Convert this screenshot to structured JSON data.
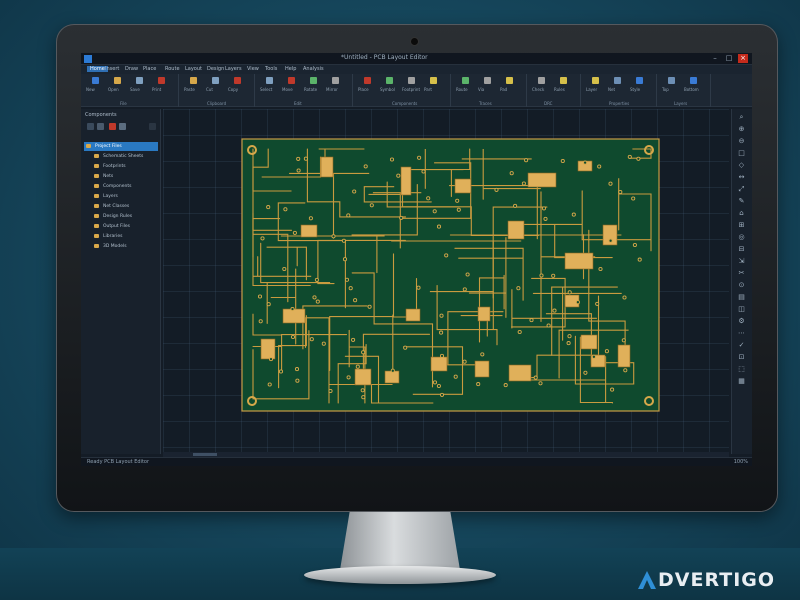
{
  "window": {
    "title": "*Untitled - PCB Layout Editor"
  },
  "menu": {
    "items": [
      "Home",
      "Insert",
      "Draw",
      "Place",
      "Route",
      "Layout",
      "Design",
      "Layers",
      "View",
      "Tools",
      "Help",
      "Analysis"
    ]
  },
  "ribbon": {
    "groups": [
      {
        "name": "File",
        "buttons": [
          "New",
          "Open",
          "Save",
          "Print"
        ]
      },
      {
        "name": "Clipboard",
        "buttons": [
          "Paste",
          "Cut",
          "Copy"
        ]
      },
      {
        "name": "Edit",
        "buttons": [
          "Select",
          "Move",
          "Rotate",
          "Mirror"
        ]
      },
      {
        "name": "Components",
        "buttons": [
          "Place",
          "Symbol",
          "Footprint",
          "Part"
        ]
      },
      {
        "name": "Traces",
        "buttons": [
          "Route",
          "Via",
          "Pad"
        ]
      },
      {
        "name": "DRC",
        "buttons": [
          "Check",
          "Rules"
        ]
      },
      {
        "name": "Properties",
        "buttons": [
          "Layer",
          "Net",
          "Style"
        ]
      },
      {
        "name": "Layers",
        "buttons": [
          "Top",
          "Bottom"
        ]
      }
    ]
  },
  "panel": {
    "title": "Components",
    "items": [
      "Project Files",
      "Schematic Sheets",
      "Footprints",
      "Nets",
      "Components",
      "Layers",
      "Net Classes",
      "Design Rules",
      "Output Files",
      "Libraries",
      "3D Models"
    ],
    "selected_index": 0
  },
  "status": {
    "text": "Ready    PCB Layout Editor",
    "right": "100%"
  },
  "brand": {
    "name": "DVERTIGO",
    "color": "#e9eef2",
    "mark_color": "#2f8fd6"
  },
  "colors": {
    "board": "#0f4a2e",
    "copper": "#d6a84a",
    "accent": "#2f7bd6"
  }
}
